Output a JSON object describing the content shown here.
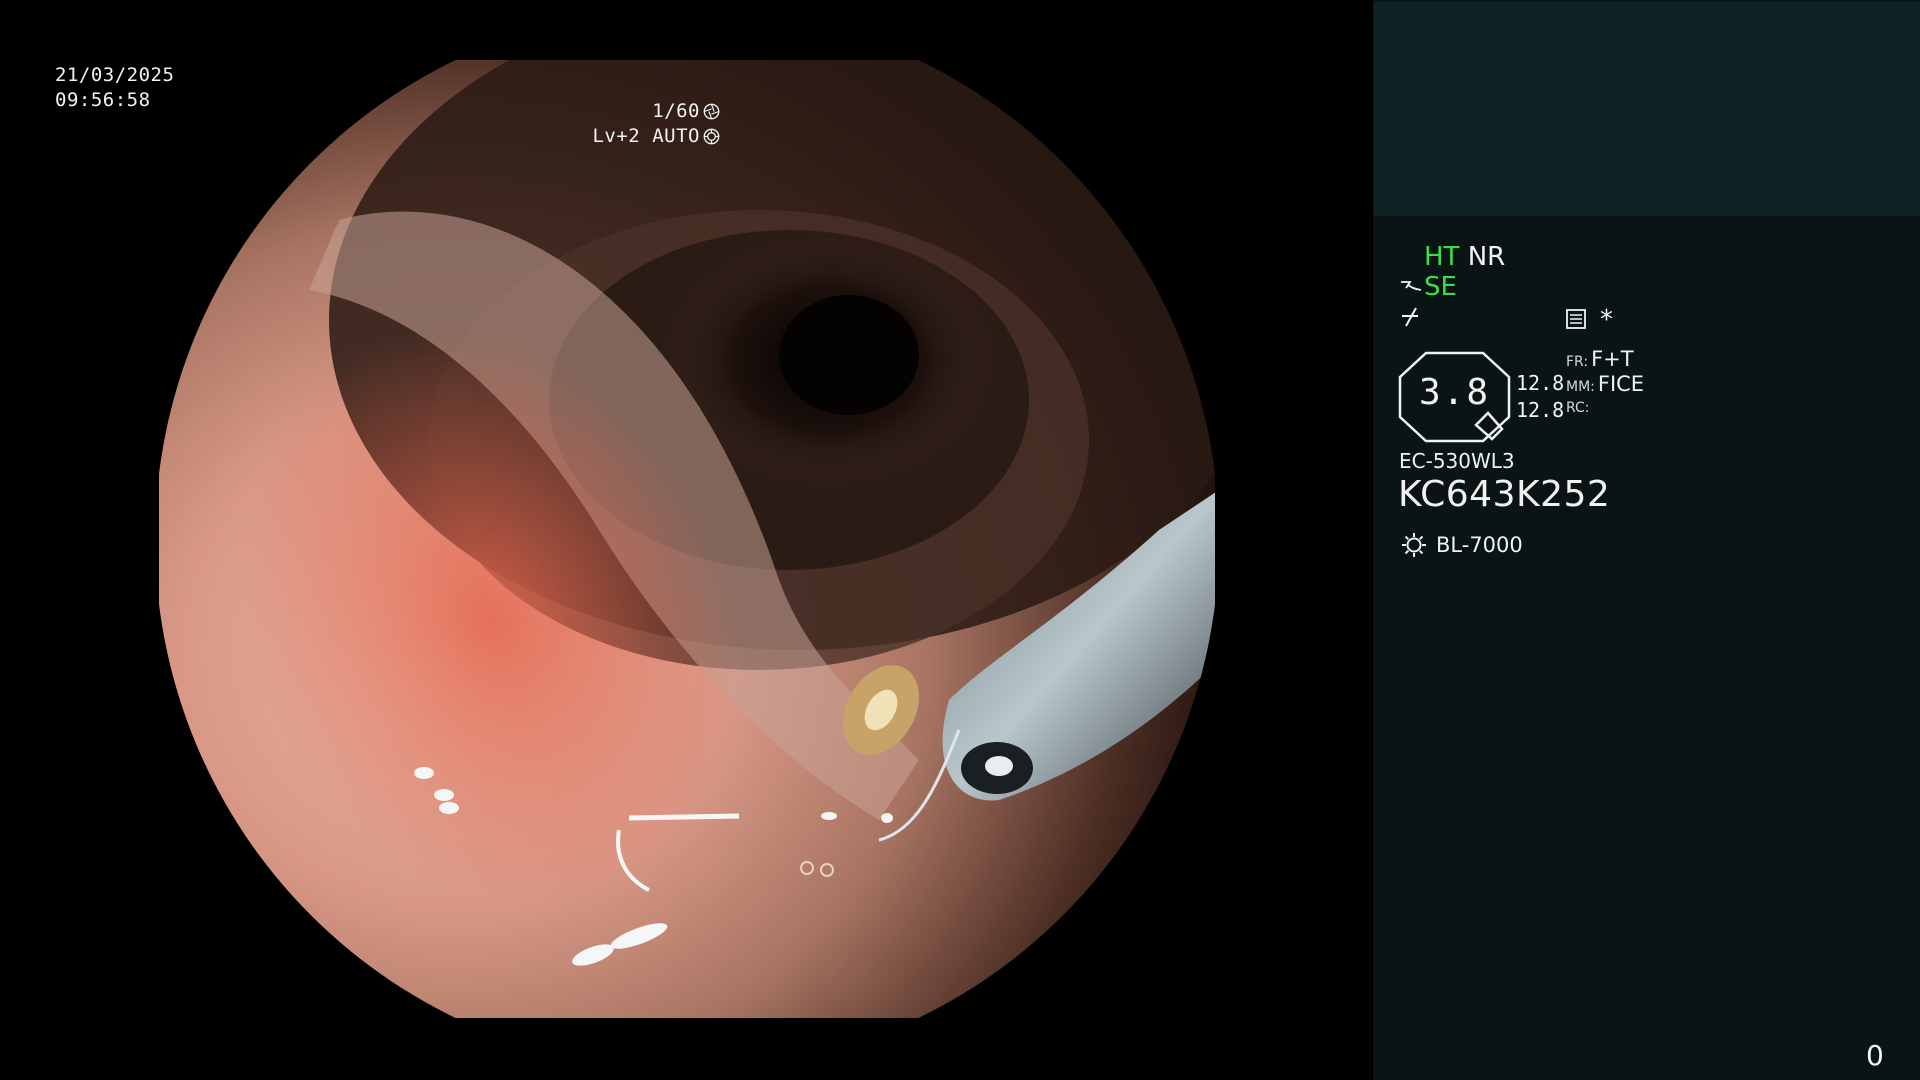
{
  "overlay": {
    "date": "21/03/2025",
    "time": "09:56:58",
    "shutter": "1/60",
    "brightness": "Lv+2",
    "exposure_mode": "AUTO"
  },
  "panel": {
    "ht": "HT",
    "nr": "NR",
    "se": "SE",
    "star": "*",
    "zoom_value": "3.8",
    "value_1": "12.8",
    "value_2": "12.8",
    "fr_label": "FR:",
    "fr_value": "F+T",
    "mm_label": "MM:",
    "mm_value": "FICE",
    "rc_label": "RC:",
    "rc_value": "",
    "scope_model": "EC-530WL3",
    "scope_serial": "KC643K252",
    "light_source": "BL-7000",
    "counter": "0"
  },
  "colors": {
    "background": "#000000",
    "panel_bg": "#0a1414",
    "panel_top": "#0f2224",
    "active_green": "#37e04b",
    "text": "#f2f2f2"
  },
  "icons": [
    "shutter-icon",
    "auto-iris-icon",
    "se-prefix-icon",
    "slash-icon",
    "memo-icon",
    "light-source-icon"
  ]
}
